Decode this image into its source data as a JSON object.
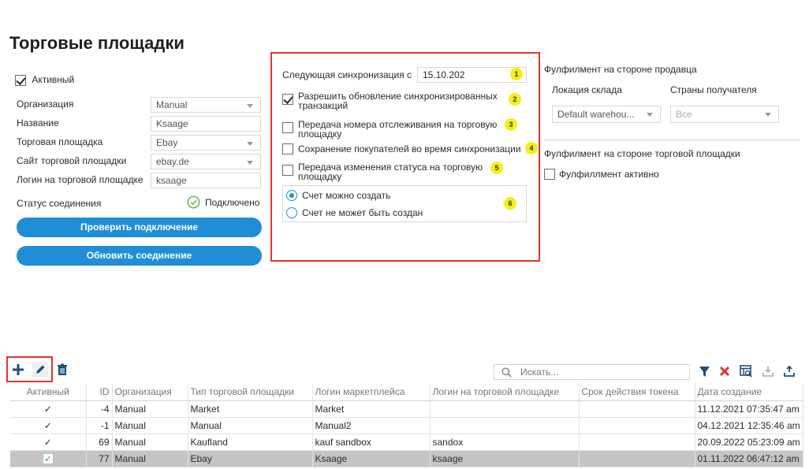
{
  "page_title": "Торговые площадки",
  "left": {
    "active_label": "Активный",
    "fields": [
      {
        "label": "Организация",
        "value": "Manual"
      },
      {
        "label": "Название",
        "value": "Ksaage"
      },
      {
        "label": "Торговая площадка",
        "value": "Ebay"
      },
      {
        "label": "Сайт торговой площадки",
        "value": "ebay.de"
      },
      {
        "label": "Логин на торговой площадке",
        "value": "ksaage"
      }
    ],
    "status_label": "Статус соединения",
    "status_value": "Подключено",
    "check_button": "Проверить подключение",
    "refresh_button": "Обновить соединение"
  },
  "sync": {
    "next_sync_label": "Следующая синхронизация с",
    "next_sync_value": "15.10.202",
    "options": [
      {
        "line1": "Разрешить обновление синхронизированных",
        "line2": "транзакций",
        "checked": true,
        "badge": "2"
      },
      {
        "line1": "Передача номера отслеживания на торговую",
        "line2": "площадку",
        "checked": false,
        "badge": "3"
      },
      {
        "line1": "Сохранение покупателей во время синхронизации",
        "line2": "",
        "checked": false,
        "badge": "4"
      },
      {
        "line1": "Передача изменения статуса на торговую",
        "line2": "площадку",
        "checked": false,
        "badge": "5"
      }
    ],
    "badge_1": "1",
    "badge_6": "6",
    "radio_can": "Счет можно создать",
    "radio_cannot": "Счет не может быть создан"
  },
  "fulfillment": {
    "seller_title": "Фулфилмент на стороне продавца",
    "warehouse_label": "Локация склада",
    "warehouse_value": "Default warehou...",
    "countries_label": "Страны получателя",
    "countries_value": "Все",
    "marketplace_title": "Фулфилмент на стороне торговой площадки",
    "active_label": "Фулфиллмент активно"
  },
  "toolbar": {
    "search_placeholder": "Искать..."
  },
  "table": {
    "columns": [
      "Активный",
      "ID",
      "Организация",
      "Тип торговой площадки",
      "Логин маркетплейса",
      "Логин на торговой площадке",
      "Срок действия токена",
      "Дата создание"
    ],
    "rows": [
      {
        "active": "✓",
        "id": "-4",
        "org": "Manual",
        "type": "Market",
        "mp_login": "Market",
        "login": "",
        "token": "",
        "created": "11.12.2021 07:35:47 am"
      },
      {
        "active": "✓",
        "id": "-1",
        "org": "Manual",
        "type": "Manual",
        "mp_login": "Manual2",
        "login": "",
        "token": "",
        "created": "04.12.2021 12:35:46 am"
      },
      {
        "active": "✓",
        "id": "69",
        "org": "Manual",
        "type": "Kaufland",
        "mp_login": "kauf sandbox",
        "login": "sandox",
        "token": "",
        "created": "20.09.2022 05:23:09 am"
      },
      {
        "active": "✓",
        "id": "77",
        "org": "Manual",
        "type": "Ebay",
        "mp_login": "Ksaage",
        "login": "ksaage",
        "token": "",
        "created": "01.11.2022 06:47:12 am"
      }
    ]
  },
  "colors": {
    "accent": "#1f8ed6",
    "highlight_box": "#e0352b",
    "badge": "#f4ef1a"
  }
}
